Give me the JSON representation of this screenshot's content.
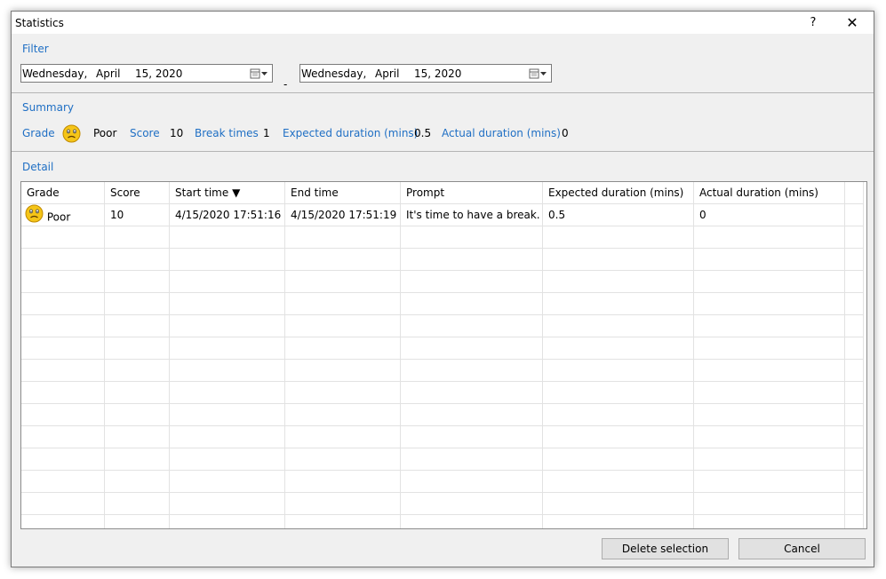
{
  "window": {
    "title": "Statistics",
    "help": "?",
    "close": "✕"
  },
  "filter": {
    "label": "Filter",
    "from": {
      "weekday": "Wednesday,",
      "month": "April",
      "day_year": "15, 2020"
    },
    "separator": "-",
    "to": {
      "weekday": "Wednesday,",
      "month": "April",
      "day_year": "15, 2020"
    }
  },
  "summary": {
    "label": "Summary",
    "grade_label": "Grade",
    "grade_value": "Poor",
    "score_label": "Score",
    "score_value": "10",
    "break_label": "Break times",
    "break_value": "1",
    "expected_label": "Expected duration (mins)",
    "expected_value": "0.5",
    "actual_label": "Actual duration (mins)",
    "actual_value": "0"
  },
  "detail": {
    "label": "Detail",
    "columns": [
      "Grade",
      "Score",
      "Start time",
      "End time",
      "Prompt",
      "Expected duration (mins)",
      "Actual duration (mins)"
    ],
    "sort_indicator": "▼",
    "rows": [
      [
        "Poor",
        "10",
        "4/15/2020 17:51:16",
        "4/15/2020 17:51:19",
        "It's time to have a break.",
        "0.5",
        "0"
      ]
    ]
  },
  "buttons": {
    "delete": "Delete selection",
    "cancel": "Cancel"
  },
  "colors": {
    "accent": "#1f6fc4",
    "face": "#f5c518"
  }
}
